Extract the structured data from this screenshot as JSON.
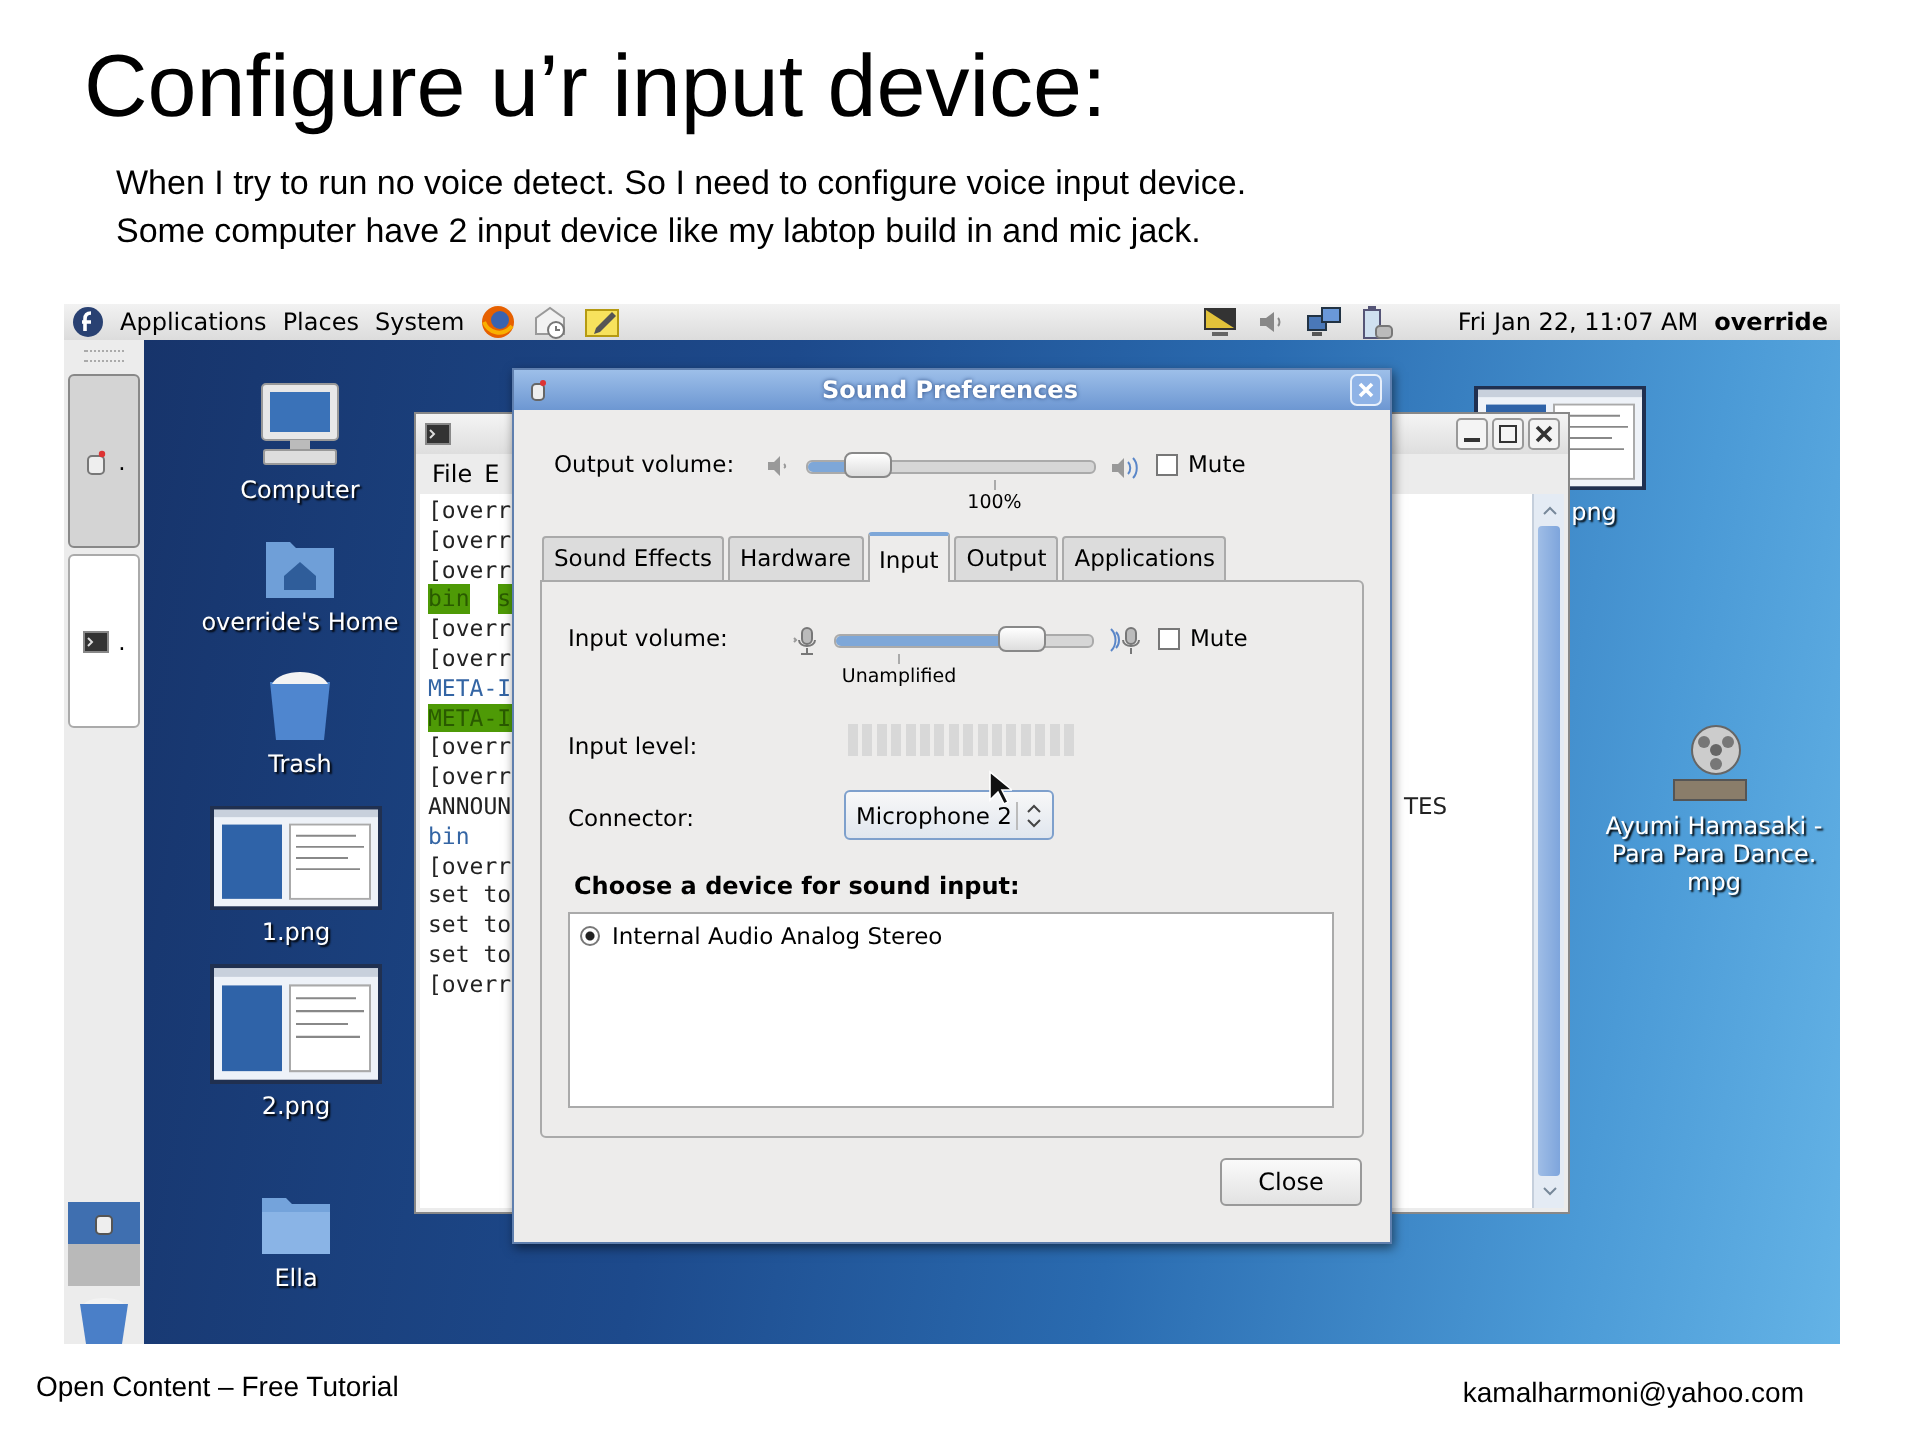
{
  "slide": {
    "title": "Configure u’r input device:",
    "lines": [
      "When I try to run no voice detect. So I need to configure voice input device.",
      "Some computer have 2 input device like my labtop build in and mic jack."
    ],
    "footer_left": "Open Content – Free Tutorial",
    "footer_right": "kamalharmoni@yahoo.com"
  },
  "top_panel": {
    "menus": [
      "Applications",
      "Places",
      "System"
    ],
    "clock": "Fri Jan 22, 11:07 AM",
    "user": "override"
  },
  "window_list": [
    {
      "label": ".",
      "selected": true,
      "kind": "sound"
    },
    {
      "label": ".",
      "selected": false,
      "kind": "terminal"
    }
  ],
  "workspaces": [
    {
      "selected": true
    },
    {
      "selected": false
    }
  ],
  "desktop_icons": [
    {
      "kind": "computer",
      "label": "Computer"
    },
    {
      "kind": "home",
      "label": "override's Home"
    },
    {
      "kind": "trash",
      "label": "Trash"
    },
    {
      "kind": "image",
      "label": "1.png"
    },
    {
      "kind": "image",
      "label": "2.png"
    },
    {
      "kind": "folder",
      "label": "Ella"
    },
    {
      "kind": "image",
      "label": "png"
    },
    {
      "kind": "video",
      "label": "Ayumi Hamasaki -\nPara Para Dance.\nmpg"
    }
  ],
  "terminal": {
    "menus": [
      "File",
      "E"
    ],
    "lines": [
      {
        "parts": [
          {
            "text": "[overr",
            "kind": "plain"
          }
        ]
      },
      {
        "parts": [
          {
            "text": "[overr",
            "kind": "plain"
          }
        ]
      },
      {
        "parts": [
          {
            "text": "[overr",
            "kind": "plain"
          }
        ]
      },
      {
        "parts": [
          {
            "text": "bin",
            "kind": "highlight"
          },
          {
            "text": "s",
            "kind": "highlight"
          }
        ]
      },
      {
        "parts": [
          {
            "text": "[overr",
            "kind": "plain"
          }
        ]
      },
      {
        "parts": [
          {
            "text": "[overr",
            "kind": "plain"
          }
        ]
      },
      {
        "parts": [
          {
            "text": "META-I",
            "kind": "blue"
          }
        ]
      },
      {
        "parts": [
          {
            "text": "META-I",
            "kind": "highlight"
          }
        ]
      },
      {
        "parts": [
          {
            "text": "[overr",
            "kind": "plain"
          }
        ]
      },
      {
        "parts": [
          {
            "text": "[overr",
            "kind": "plain"
          }
        ]
      },
      {
        "parts": [
          {
            "text": "ANNOUN",
            "kind": "plain"
          }
        ],
        "tail": "TES"
      },
      {
        "parts": [
          {
            "text": "bin",
            "kind": "blue"
          }
        ]
      },
      {
        "parts": [
          {
            "text": "[overr",
            "kind": "plain"
          }
        ]
      },
      {
        "parts": [
          {
            "text": "set to",
            "kind": "plain"
          }
        ]
      },
      {
        "parts": [
          {
            "text": "set to",
            "kind": "plain"
          }
        ]
      },
      {
        "parts": [
          {
            "text": "set to",
            "kind": "plain"
          }
        ]
      },
      {
        "parts": [
          {
            "text": "[overr",
            "kind": "plain"
          }
        ]
      }
    ]
  },
  "dialog": {
    "title": "Sound Preferences",
    "output": {
      "label": "Output volume:",
      "level": 0.21,
      "mark": "100%",
      "mute": {
        "label": "Mute",
        "checked": false
      }
    },
    "tabs": [
      {
        "label": "Sound Effects",
        "selected": false
      },
      {
        "label": "Hardware",
        "selected": false
      },
      {
        "label": "Input",
        "selected": true
      },
      {
        "label": "Output",
        "selected": false
      },
      {
        "label": "Applications",
        "selected": false
      }
    ],
    "input": {
      "label": "Input volume:",
      "level": 0.73,
      "mark": "Unamplified",
      "mute": {
        "label": "Mute",
        "checked": false
      }
    },
    "input_level": {
      "label": "Input level:"
    },
    "connector": {
      "label": "Connector:",
      "value": "Microphone 2"
    },
    "devices_heading": "Choose a device for sound input:",
    "devices": [
      {
        "name": "Internal Audio Analog Stereo",
        "selected": true
      }
    ],
    "close": "Close"
  }
}
